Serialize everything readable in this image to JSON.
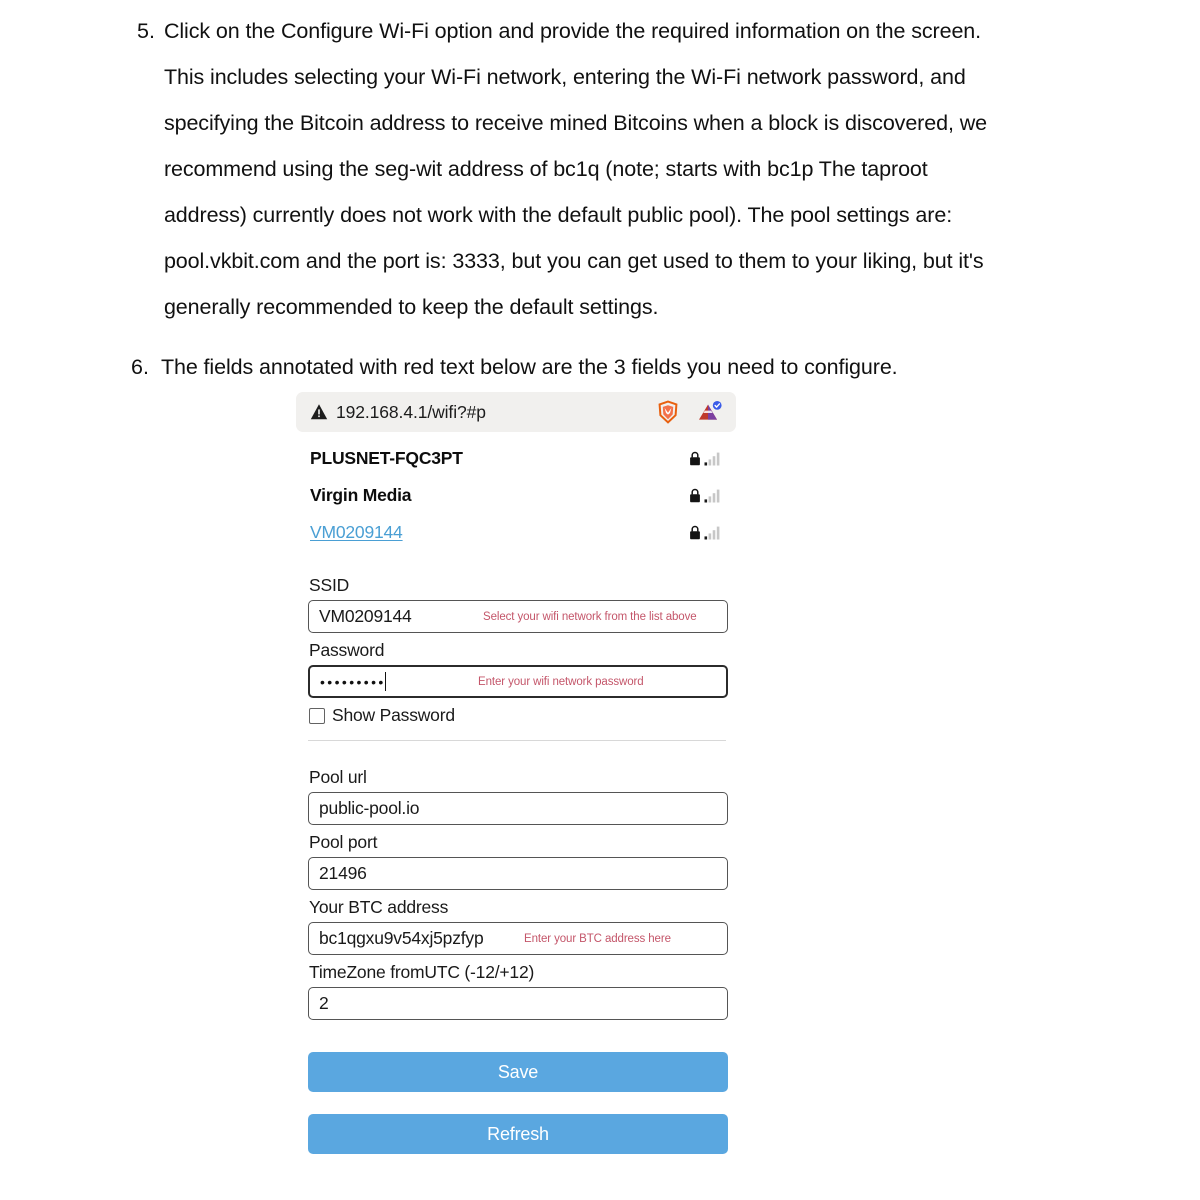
{
  "document": {
    "steps": [
      {
        "number": "5.",
        "text": "Click on the Configure Wi-Fi option and provide the required information on the screen. This includes selecting your Wi-Fi network, entering the Wi-Fi network password, and specifying the Bitcoin address to receive mined Bitcoins when a block is discovered, we recommend using the seg-wit address of bc1q (note; starts with bc1p The taproot address) currently does not work with the default public pool). The pool settings are: pool.vkbit.com and the port is: 3333, but you can get used to them to your liking, but it's generally recommended to keep the default settings."
      },
      {
        "number": "6.",
        "text": "The fields annotated with red text below are the 3 fields you need to configure."
      }
    ]
  },
  "screenshot": {
    "browser": {
      "warning_icon": "warning-triangle-icon",
      "url": "192.168.4.1/wifi?#p",
      "extensions": [
        {
          "icon": "brave-shield-icon",
          "label": "Brave Shields"
        },
        {
          "icon": "triangle-badge-icon",
          "label": "Extension"
        }
      ]
    },
    "networks": [
      {
        "ssid": "PLUSNET-FQC3PT",
        "is_link": false,
        "lock_icon": "lock-icon",
        "signal_icon": "signal-bars-icon"
      },
      {
        "ssid": "Virgin Media",
        "is_link": false,
        "lock_icon": "lock-icon",
        "signal_icon": "signal-bars-icon"
      },
      {
        "ssid": "VM0209144",
        "is_link": true,
        "lock_icon": "lock-icon",
        "signal_icon": "signal-bars-icon"
      }
    ],
    "form": {
      "ssid": {
        "label": "SSID",
        "value": "VM0209144",
        "annotation": "Select your wifi network from the list above"
      },
      "password": {
        "label": "Password",
        "value": "•••••••••",
        "annotation": "Enter your wifi network password"
      },
      "show_password": {
        "label": "Show Password",
        "checked": false
      },
      "pool_url": {
        "label": "Pool url",
        "value": "public-pool.io"
      },
      "pool_port": {
        "label": "Pool port",
        "value": "21496"
      },
      "btc_address": {
        "label": "Your BTC address",
        "value": "bc1qgxu9v54xj5pzfyp",
        "annotation": "Enter your BTC address here"
      },
      "timezone": {
        "label": "TimeZone fromUTC (-12/+12)",
        "value": "2"
      }
    },
    "buttons": {
      "save": "Save",
      "refresh": "Refresh"
    },
    "colors": {
      "button_blue": "#5aa7e0",
      "annotation_red": "#c4566a",
      "link_blue": "#4a9fd4",
      "urlbar_bg": "#f1f0ee"
    }
  }
}
